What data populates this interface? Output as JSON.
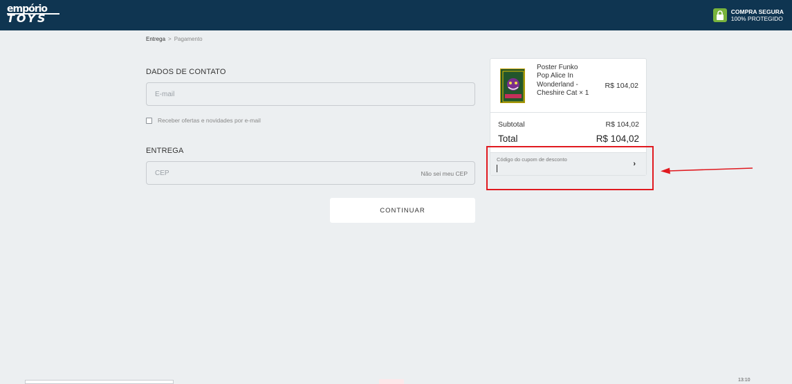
{
  "header": {
    "logo_line1": "empório",
    "logo_line2": "TOYS",
    "secure_line1": "COMPRA SEGURA",
    "secure_line2": "100% PROTEGIDO",
    "icon": "lock-icon"
  },
  "breadcrumb": {
    "step1": "Entrega",
    "separator": ">",
    "step2": "Pagamento"
  },
  "contact": {
    "title": "DADOS DE CONTATO",
    "email_placeholder": "E-mail",
    "newsletter_label": "Receber ofertas e novidades por e-mail"
  },
  "delivery": {
    "title": "ENTREGA",
    "cep_placeholder": "CEP",
    "cep_link": "Não sei meu CEP"
  },
  "continue_label": "CONTINUAR",
  "summary": {
    "product_name": "Poster Funko Pop Alice In Wonderland - Cheshire Cat × 1",
    "product_price": "R$ 104,02",
    "subtotal_label": "Subtotal",
    "subtotal_value": "R$ 104,02",
    "total_label": "Total",
    "total_value": "R$ 104,02",
    "coupon_label": "Código do cupom de desconto",
    "coupon_arrow": "›"
  },
  "colors": {
    "header_bg": "#0f3551",
    "page_bg": "#eceff1",
    "annotation": "#e0191f",
    "secure_badge": "#78b33c"
  },
  "taskbar": {
    "time": "13:10"
  }
}
